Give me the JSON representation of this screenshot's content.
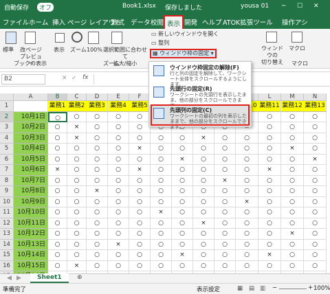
{
  "title_bar": {
    "autosave": "自動保存",
    "autosave_state": "オフ",
    "filename": "Book1.xlsx",
    "saved": "保存しました",
    "user": "yousa 01"
  },
  "tabs": [
    "ファイル",
    "ホーム",
    "挿入",
    "ページ レイアウト",
    "数式",
    "データ",
    "校閲",
    "表示",
    "開発",
    "ヘルプ",
    "ATOK拡張ツール",
    "操作アシ"
  ],
  "active_tab": "表示",
  "ribbon": {
    "normal": "標準",
    "page_break": "改ページ\nプレビュー",
    "display": "表示",
    "zoom": "ズーム",
    "zoom100": "100%",
    "zoom_sel": "選択範囲に合わせて\n拡大/縮小",
    "new_window": "新しいウインドウを開く",
    "arrange": "整列",
    "freeze": "ウィンドウ枠の固定",
    "switch_window": "ウィンドウの\n切り替え",
    "macro": "マクロ",
    "group_book_view": "ブックの表示",
    "group_zoom": "ズーム",
    "group_macro": "マクロ"
  },
  "formula_bar": {
    "name_box": "B2",
    "fx": "fx"
  },
  "freeze_menu": [
    {
      "title": "ウインドウ枠固定の解除(F)",
      "desc": "行と列の固定を解除して、ワークシート全体をスクロールするようにします。"
    },
    {
      "title": "先頭行の固定(R)",
      "desc": "ワークシートの先頭行を表示したまま、他の部分をスクロールできます。"
    },
    {
      "title": "先頭列の固定(C)",
      "desc": "ワークシートの最初の列を表示したままで、他の部分をスクロールできます。"
    }
  ],
  "columns": [
    "A",
    "B",
    "C",
    "D",
    "E",
    "F",
    "G",
    "H",
    "I",
    "J",
    "K",
    "L",
    "M",
    "N"
  ],
  "header_row": [
    "",
    "業務1",
    "業務2",
    "業務3",
    "業務4",
    "業務5",
    "",
    "",
    "",
    "",
    "業務10",
    "業務11",
    "業務12",
    "業務13"
  ],
  "rows": [
    {
      "n": "2",
      "date": "10月1日",
      "v": [
        "○",
        "○",
        "○",
        "○",
        "○",
        "○",
        "○",
        "○",
        "○",
        "○",
        "○",
        "○",
        "○"
      ]
    },
    {
      "n": "3",
      "date": "10月2日",
      "v": [
        "○",
        "×",
        "○",
        "○",
        "○",
        "○",
        "○",
        "○",
        "○",
        "×",
        "○",
        "○",
        "○"
      ]
    },
    {
      "n": "4",
      "date": "10月3日",
      "v": [
        "○",
        "×",
        "○",
        "○",
        "○",
        "○",
        "○",
        "×",
        "○",
        "○",
        "○",
        "○",
        "○"
      ]
    },
    {
      "n": "5",
      "date": "10月4日",
      "v": [
        "○",
        "○",
        "○",
        "○",
        "×",
        "○",
        "○",
        "○",
        "○",
        "○",
        "○",
        "×",
        "○"
      ]
    },
    {
      "n": "6",
      "date": "10月5日",
      "v": [
        "○",
        "○",
        "○",
        "○",
        "○",
        "○",
        "×",
        "○",
        "○",
        "○",
        "○",
        "○",
        "×"
      ]
    },
    {
      "n": "7",
      "date": "10月6日",
      "v": [
        "×",
        "○",
        "○",
        "○",
        "×",
        "○",
        "○",
        "○",
        "○",
        "○",
        "×",
        "○",
        "○"
      ]
    },
    {
      "n": "8",
      "date": "10月7日",
      "v": [
        "○",
        "○",
        "○",
        "○",
        "○",
        "○",
        "○",
        "○",
        "×",
        "○",
        "○",
        "○",
        "○"
      ]
    },
    {
      "n": "9",
      "date": "10月8日",
      "v": [
        "○",
        "○",
        "×",
        "○",
        "○",
        "○",
        "○",
        "○",
        "○",
        "○",
        "○",
        "○",
        "○"
      ]
    },
    {
      "n": "10",
      "date": "10月9日",
      "v": [
        "○",
        "○",
        "○",
        "○",
        "○",
        "○",
        "○",
        "○",
        "○",
        "×",
        "○",
        "○",
        "○"
      ]
    },
    {
      "n": "11",
      "date": "10月10日",
      "v": [
        "○",
        "○",
        "○",
        "○",
        "○",
        "×",
        "○",
        "○",
        "○",
        "○",
        "○",
        "○",
        "○"
      ]
    },
    {
      "n": "12",
      "date": "10月11日",
      "v": [
        "○",
        "○",
        "○",
        "○",
        "○",
        "○",
        "○",
        "×",
        "○",
        "○",
        "○",
        "○",
        "○"
      ]
    },
    {
      "n": "13",
      "date": "10月12日",
      "v": [
        "○",
        "○",
        "○",
        "○",
        "○",
        "○",
        "○",
        "○",
        "○",
        "○",
        "○",
        "×",
        "○"
      ]
    },
    {
      "n": "14",
      "date": "10月13日",
      "v": [
        "○",
        "○",
        "○",
        "×",
        "○",
        "○",
        "○",
        "○",
        "○",
        "○",
        "○",
        "○",
        "○"
      ]
    },
    {
      "n": "15",
      "date": "10月14日",
      "v": [
        "○",
        "○",
        "○",
        "○",
        "○",
        "○",
        "×",
        "○",
        "○",
        "○",
        "×",
        "○",
        "○"
      ]
    },
    {
      "n": "16",
      "date": "10月15日",
      "v": [
        "○",
        "×",
        "○",
        "○",
        "○",
        "○",
        "○",
        "○",
        "○",
        "○",
        "○",
        "○",
        "○"
      ]
    },
    {
      "n": "17",
      "date": "10月16日",
      "v": [
        "○",
        "○",
        "○",
        "○",
        "○",
        "○",
        "○",
        "○",
        "○",
        "×",
        "○",
        "○",
        "○"
      ]
    }
  ],
  "row1_label": "1",
  "sheet_tab": "Sheet1",
  "status": {
    "ready": "準備完了",
    "display_settings": "表示設定",
    "zoom": "100%"
  }
}
